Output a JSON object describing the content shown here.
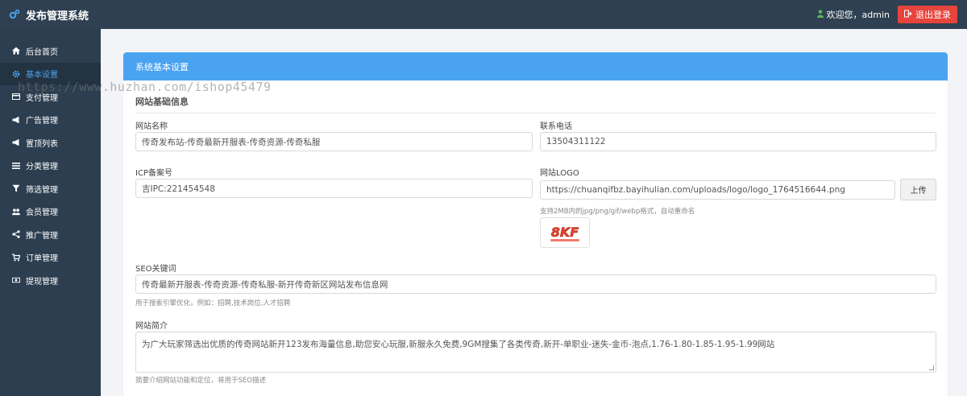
{
  "app": {
    "title": "发布管理系统"
  },
  "header": {
    "welcome": "欢迎您，admin",
    "logout_label": "退出登录"
  },
  "sidebar": {
    "items": [
      {
        "label": "后台首页",
        "icon": "home-icon"
      },
      {
        "label": "基本设置",
        "icon": "gear-icon",
        "active": true
      },
      {
        "label": "支付管理",
        "icon": "credit-card-icon"
      },
      {
        "label": "广告管理",
        "icon": "bullhorn-icon"
      },
      {
        "label": "置顶列表",
        "icon": "bullhorn-icon"
      },
      {
        "label": "分类管理",
        "icon": "list-icon"
      },
      {
        "label": "筛选管理",
        "icon": "filter-icon"
      },
      {
        "label": "会员管理",
        "icon": "users-icon"
      },
      {
        "label": "推广管理",
        "icon": "share-icon"
      },
      {
        "label": "订单管理",
        "icon": "cart-icon"
      },
      {
        "label": "提现管理",
        "icon": "money-icon"
      }
    ]
  },
  "watermark": "https://www.huzhan.com/ishop45479",
  "panel": {
    "title": "系统基本设置",
    "section_title": "网站基础信息",
    "site_name": {
      "label": "网站名称",
      "value": "传奇发布站-传奇最新开服表-传奇资源-传奇私服"
    },
    "phone": {
      "label": "联系电话",
      "value": "13504311122"
    },
    "icp": {
      "label": "ICP备案号",
      "value": "吉IPC:221454548"
    },
    "logo": {
      "label": "网站LOGO",
      "value": "https://chuanqifbz.bayihulian.com/uploads/logo/logo_1764516644.png",
      "upload_label": "上传",
      "help": "支持2MB内的jpg/png/gif/webp格式，自动重命名",
      "preview_text": "8KF"
    },
    "seo_keywords": {
      "label": "SEO关键词",
      "value": "传奇最新开服表-传奇资源-传奇私服-新开传奇新区网站发布信息网",
      "help": "用于搜索引擎优化，例如：招聘,技术岗位,人才招聘"
    },
    "description": {
      "label": "网站简介",
      "value": "为广大玩家筛选出优质的传奇网站新开123发布海量信息,助您安心玩服,新服永久免费,9GM搜集了各类传奇,新开-单职业-迷失-金币-泡点,1.76-1.80-1.85-1.95-1.99网站",
      "help": "简要介绍网站功能和定位，将用于SEO描述"
    }
  },
  "colors": {
    "topbar": "#2f4052",
    "sidebar": "#2c3e50",
    "accent": "#4aa3f0",
    "logout": "#e6443c"
  }
}
